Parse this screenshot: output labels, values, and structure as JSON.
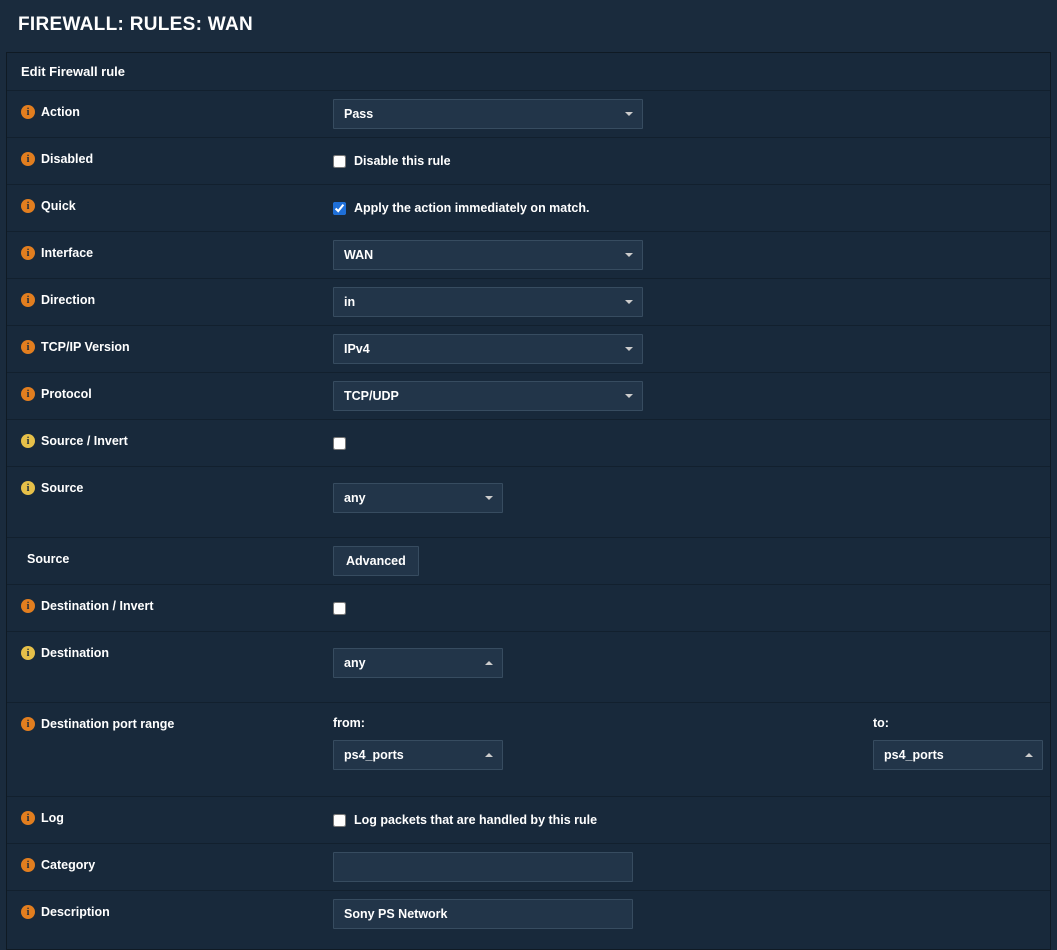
{
  "pageTitle": "FIREWALL: RULES: WAN",
  "panelTitle": "Edit Firewall rule",
  "labels": {
    "action": "Action",
    "disabled": "Disabled",
    "quick": "Quick",
    "interface": "Interface",
    "direction": "Direction",
    "tcpip": "TCP/IP Version",
    "protocol": "Protocol",
    "sourceInvert": "Source / Invert",
    "source": "Source",
    "sourceAdv": "Source",
    "destInvert": "Destination / Invert",
    "destination": "Destination",
    "destPortRange": "Destination port range",
    "log": "Log",
    "category": "Category",
    "description": "Description"
  },
  "values": {
    "action": "Pass",
    "disabledChecked": false,
    "disabledText": "Disable this rule",
    "quickChecked": true,
    "quickText": "Apply the action immediately on match.",
    "interface": "WAN",
    "direction": "in",
    "tcpip": "IPv4",
    "protocol": "TCP/UDP",
    "sourceInvertChecked": false,
    "source": "any",
    "advancedBtn": "Advanced",
    "destInvertChecked": false,
    "destination": "any",
    "portFromLabel": "from:",
    "portToLabel": "to:",
    "portFrom": "ps4_ports",
    "portTo": "ps4_ports",
    "logChecked": false,
    "logText": "Log packets that are handled by this rule",
    "category": "",
    "description": "Sony PS Network"
  }
}
